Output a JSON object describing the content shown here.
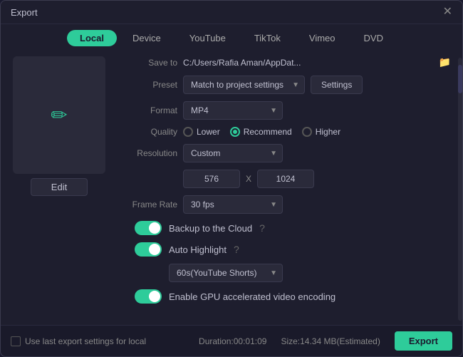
{
  "window": {
    "title": "Export",
    "close_label": "✕"
  },
  "tabs": [
    {
      "id": "local",
      "label": "Local",
      "active": true
    },
    {
      "id": "device",
      "label": "Device",
      "active": false
    },
    {
      "id": "youtube",
      "label": "YouTube",
      "active": false
    },
    {
      "id": "tiktok",
      "label": "TikTok",
      "active": false
    },
    {
      "id": "vimeo",
      "label": "Vimeo",
      "active": false
    },
    {
      "id": "dvd",
      "label": "DVD",
      "active": false
    }
  ],
  "preview": {
    "edit_label": "Edit"
  },
  "fields": {
    "save_to_label": "Save to",
    "save_to_value": "C:/Users/Rafia Aman/AppDat...",
    "preset_label": "Preset",
    "preset_value": "Match to project settings",
    "settings_label": "Settings",
    "format_label": "Format",
    "format_value": "MP4",
    "quality_label": "Quality",
    "quality_lower": "Lower",
    "quality_recommend": "Recommend",
    "quality_higher": "Higher",
    "resolution_label": "Resolution",
    "resolution_value": "Custom",
    "resolution_w": "576",
    "resolution_x": "X",
    "resolution_h": "1024",
    "frame_rate_label": "Frame Rate",
    "frame_rate_value": "30 fps"
  },
  "toggles": {
    "backup_label": "Backup to the Cloud",
    "auto_highlight_label": "Auto Highlight",
    "gpu_label": "Enable GPU accelerated video encoding",
    "highlight_dropdown": "60s(YouTube Shorts)"
  },
  "bottom": {
    "checkbox_label": "Use last export settings for local",
    "duration_label": "Duration:00:01:09",
    "size_label": "Size:14.34 MB(Estimated)",
    "export_label": "Export"
  }
}
